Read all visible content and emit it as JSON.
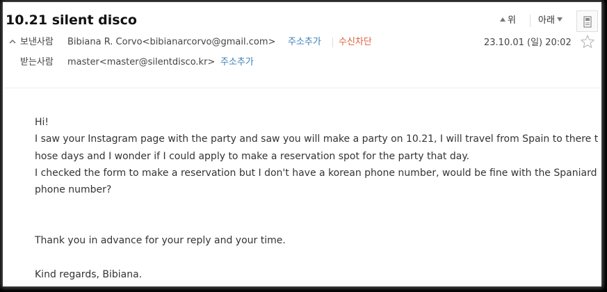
{
  "mail": {
    "subject": "10.21 silent disco",
    "nav": {
      "up_label": "위",
      "down_label": "아래"
    },
    "from": {
      "label": "보낸사람",
      "value": "Bibiana R. Corvo<bibianarcorvo@gmail.com>",
      "add_contact": "주소추가",
      "block": "수신차단"
    },
    "to": {
      "label": "받는사람",
      "value": "master<master@silentdisco.kr>",
      "add_contact": "주소추가"
    },
    "datetime": "23.10.01 (일) 20:02",
    "body_lines": [
      "Hi!",
      "I saw your Instagram page with the party and saw you will make a party on 10.21, I will travel from Spain to there t",
      "hose days and I wonder if I could apply to make a reservation spot for the party that day.",
      "I checked the form to make a reservation but I don't have a korean phone number, would be fine with the Spaniard",
      "phone number?",
      "",
      "",
      "Thank you in advance for your reply and your time.",
      "",
      "Kind regards, Bibiana."
    ]
  },
  "icons": {
    "print": "print-icon",
    "star": "star-icon",
    "collapse": "chevron-up-icon"
  },
  "colors": {
    "link": "#3b7fb8",
    "block": "#e0603a"
  }
}
